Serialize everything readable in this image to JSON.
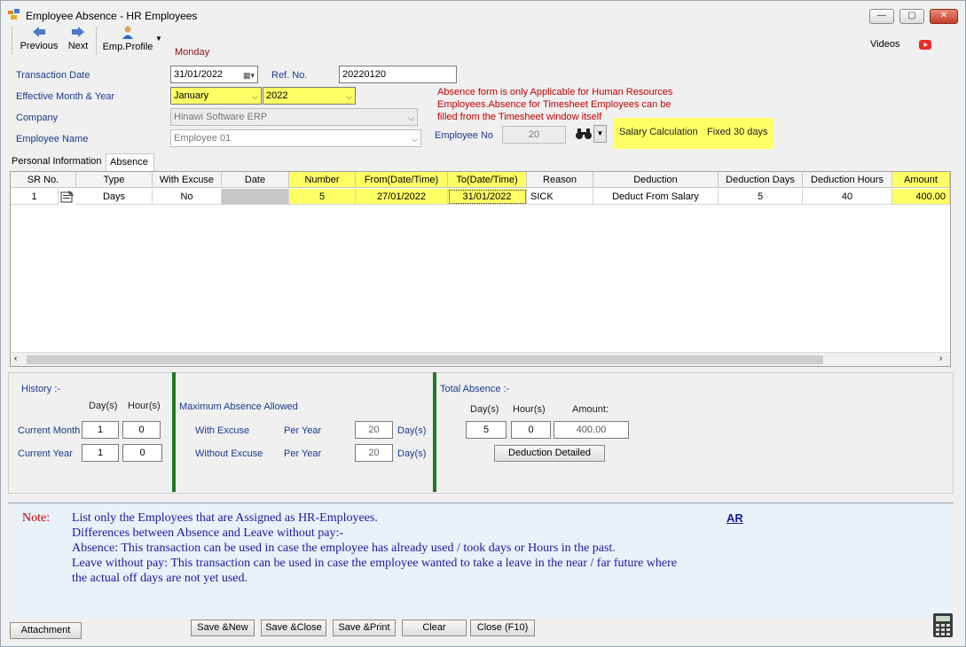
{
  "window": {
    "title": "Employee Absence - HR Employees",
    "min": "—",
    "max": "▢",
    "close": "✕"
  },
  "toolbar": {
    "previous": "Previous",
    "next": "Next",
    "emp_profile": "Emp.Profile",
    "day": "Monday",
    "videos": "Videos"
  },
  "form": {
    "transaction_date_label": "Transaction Date",
    "transaction_date": "31/01/2022",
    "ref_no_label": "Ref. No.",
    "ref_no": "20220120",
    "effective_label": "Effective Month & Year",
    "month": "January",
    "year": "2022",
    "company_label": "Company",
    "company": "Hinawi Software ERP",
    "employee_name_label": "Employee Name",
    "employee_name": "Employee 01",
    "employee_no_label": "Employee No",
    "employee_no": "20",
    "notice": [
      "Absence form is only Applicable for Human Resources",
      "Employees.Absence for Timesheet Employees can be",
      "filled from the Timesheet window itself"
    ],
    "salary_calc_label": "Salary Calculation",
    "salary_calc_value": "Fixed 30 days"
  },
  "tabs": [
    "Personal Information",
    "Absence"
  ],
  "grid": {
    "columns": [
      "SR No.",
      "Type",
      "With Excuse",
      "Date",
      "Number",
      "From(Date/Time)",
      "To(Date/Time)",
      "Reason",
      "Deduction",
      "Deduction Days",
      "Deduction Hours",
      "Amount"
    ],
    "rows": [
      {
        "sr": "1",
        "type": "Days",
        "excuse": "No",
        "date": "",
        "number": "5",
        "from": "27/01/2022",
        "to": "31/01/2022",
        "reason": "SICK",
        "deduction": "Deduct From Salary",
        "ded_days": "5",
        "ded_hours": "40",
        "amount": "400.00"
      }
    ]
  },
  "history": {
    "title": "History :-",
    "days_label": "Day(s)",
    "hours_label": "Hour(s)",
    "current_month_label": "Current Month",
    "cm_days": "1",
    "cm_hours": "0",
    "current_year_label": "Current Year",
    "cy_days": "1",
    "cy_hours": "0"
  },
  "max_absence": {
    "title": "Maximum Absence Allowed",
    "with_excuse_label": "With Excuse",
    "without_excuse_label": "Without Excuse",
    "per_year": "Per Year",
    "with_value": "20",
    "without_value": "20",
    "days_unit": "Day(s)"
  },
  "total": {
    "title": "Total Absence :-",
    "days_label": "Day(s)",
    "hours_label": "Hour(s)",
    "amount_label": "Amount:",
    "days": "5",
    "hours": "0",
    "amount": "400.00",
    "detail_button": "Deduction Detailed"
  },
  "notes": {
    "label": "Note:",
    "ar_link": "AR",
    "lines": [
      "List only the Employees that are Assigned as HR-Employees.",
      "Differences between Absence and Leave without pay:-",
      "Absence: This transaction can be used in case the employee has already used / took days or Hours in the past.",
      "Leave without pay: This transaction can be used in case the employee wanted to take a leave in the near / far future where",
      "the actual off days are not yet used."
    ]
  },
  "footer": {
    "attachment": "Attachment",
    "save_new": "Save &New",
    "save_close": "Save &Close",
    "save_print": "Save &Print",
    "clear": "Clear",
    "close": "Close (F10)"
  }
}
